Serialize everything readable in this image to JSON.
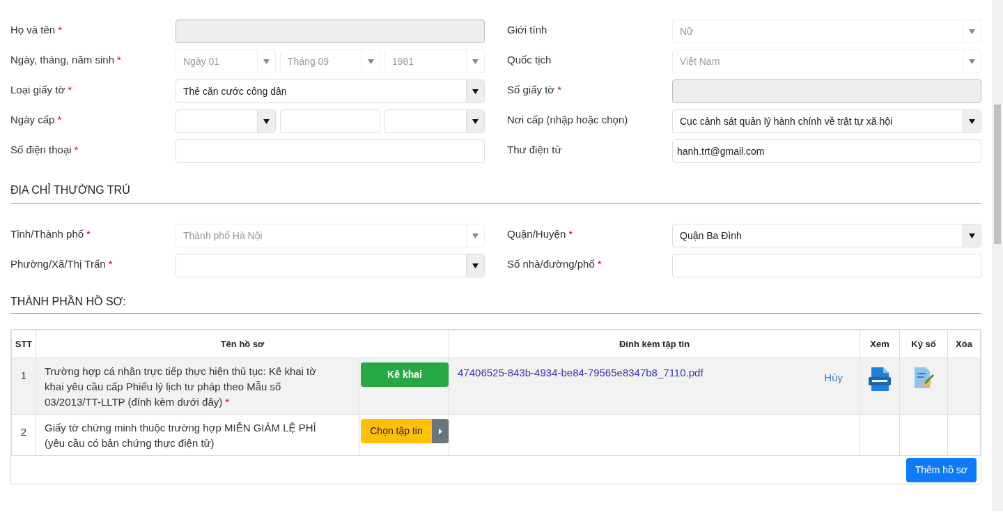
{
  "personal": {
    "left": [
      {
        "label": "Họ và tên",
        "asterisk": "*",
        "kind": "input",
        "disabled": true
      },
      {
        "label": "Ngày, tháng, năm sinh",
        "asterisk": "*",
        "kind": "multi",
        "parts": [
          {
            "kind": "select",
            "value": "Ngày 01",
            "disabled": true
          },
          {
            "kind": "select",
            "value": "Tháng 09",
            "disabled": true
          },
          {
            "kind": "select",
            "value": "1981",
            "disabled": true
          }
        ]
      },
      {
        "label": "Loại giấy tờ",
        "asterisk": "*",
        "kind": "select",
        "value": "Thẻ căn cước công dân",
        "disabled": false
      },
      {
        "label": "Ngày cấp",
        "asterisk": "*",
        "kind": "multi",
        "parts": [
          {
            "kind": "select",
            "disabled": false
          },
          {
            "kind": "input",
            "disabled": false
          },
          {
            "kind": "select",
            "disabled": false
          }
        ]
      },
      {
        "label": "Số điện thoại",
        "asterisk": "*",
        "kind": "input",
        "disabled": false
      }
    ],
    "right": [
      {
        "label": "Giới tính",
        "kind": "select",
        "value": "Nữ",
        "disabled": true
      },
      {
        "label": "Quốc tịch",
        "kind": "select",
        "value": "Việt Nam",
        "disabled": true
      },
      {
        "label": "Số giấy tờ",
        "asterisk": "*",
        "kind": "input",
        "disabled": true
      },
      {
        "label": "Nơi cấp (nhập hoặc chọn)",
        "kind": "select",
        "value": "Cục cảnh sát quản lý hành chính về trật tự xã hội",
        "disabled": false
      },
      {
        "label": "Thư điện tử",
        "kind": "input",
        "value": "hanh.trt@gmail.com",
        "disabled": false
      }
    ]
  },
  "address": {
    "title": "ĐỊA CHỈ THƯỜNG TRÚ",
    "left": [
      {
        "label": "Tỉnh/Thành phố",
        "asterisk": "*",
        "kind": "select",
        "value": "Thành phố Hà Nội",
        "disabled": true
      },
      {
        "label": "Phường/Xã/Thị Trấn",
        "asterisk": "*",
        "kind": "select",
        "disabled": false
      }
    ],
    "right": [
      {
        "label": "Quận/Huyện",
        "asterisk": "*",
        "kind": "select",
        "value": "Quận Ba Đình",
        "disabled": false
      },
      {
        "label": "Số nhà/đường/phố",
        "asterisk": "*",
        "kind": "input",
        "disabled": false
      }
    ]
  },
  "documents": {
    "title": "THÀNH PHẦN HỒ SƠ:",
    "columns": [
      "STT",
      "Tên hồ sơ",
      "Đính kèm tập tin",
      "Xem",
      "Ký số",
      "Xóa"
    ],
    "rows": [
      {
        "stt": "1",
        "name": "Trường hợp cá nhân trực tiếp thực hiện thủ tục: Kê khai tờ khai yêu cầu cấp Phiếu lý lịch tư pháp theo Mẫu số 03/2013/TT-LLTP (đính kèm dưới đây)",
        "asterisk": "*",
        "action": {
          "kind": "declare",
          "label": "Kê khai"
        },
        "file": "47406525-843b-4934-be84-79565e8347b8_7110.pdf",
        "cancel": "Hủy",
        "view": true,
        "sign": true
      },
      {
        "stt": "2",
        "name": "Giấy tờ chứng minh thuộc trường hợp MIỄN GIẢM LỆ PHÍ (yêu cầu có bản chứng thực điện tử)",
        "action": {
          "kind": "choose",
          "label": "Chọn tập tin"
        },
        "view": false,
        "sign": false
      }
    ],
    "add_button": "Thêm hồ sơ"
  }
}
